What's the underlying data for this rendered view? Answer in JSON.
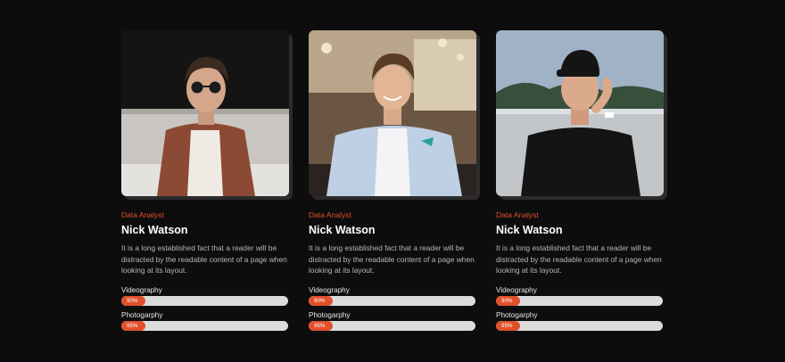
{
  "cards": [
    {
      "role": "Data Analyst",
      "name": "Nick Watson",
      "description": "It is a long established fact that a reader will be distracted by the readable content of a page when looking at its layout.",
      "skills": [
        {
          "label": "Videography",
          "percent_text": "90%",
          "value": 0.9
        },
        {
          "label": "Photogarphy",
          "percent_text": "95%",
          "value": 0.95
        }
      ]
    },
    {
      "role": "Data Analyst",
      "name": "Nick Watson",
      "description": "It is a long established fact that a reader will be distracted by the readable content of a page when looking at its layout.",
      "skills": [
        {
          "label": "Videography",
          "percent_text": "90%",
          "value": 0.9
        },
        {
          "label": "Photogarphy",
          "percent_text": "95%",
          "value": 0.95
        }
      ]
    },
    {
      "role": "Data Analyst",
      "name": "Nick Watson",
      "description": "It is a long established fact that a reader will be distracted by the readable content of a page when looking at its layout.",
      "skills": [
        {
          "label": "Videography",
          "percent_text": "90%",
          "value": 0.9
        },
        {
          "label": "Photogarphy",
          "percent_text": "95%",
          "value": 0.95
        }
      ]
    }
  ],
  "colors": {
    "accent": "#e2502b",
    "background": "#0d0d0d",
    "track": "#dcdcdc"
  }
}
